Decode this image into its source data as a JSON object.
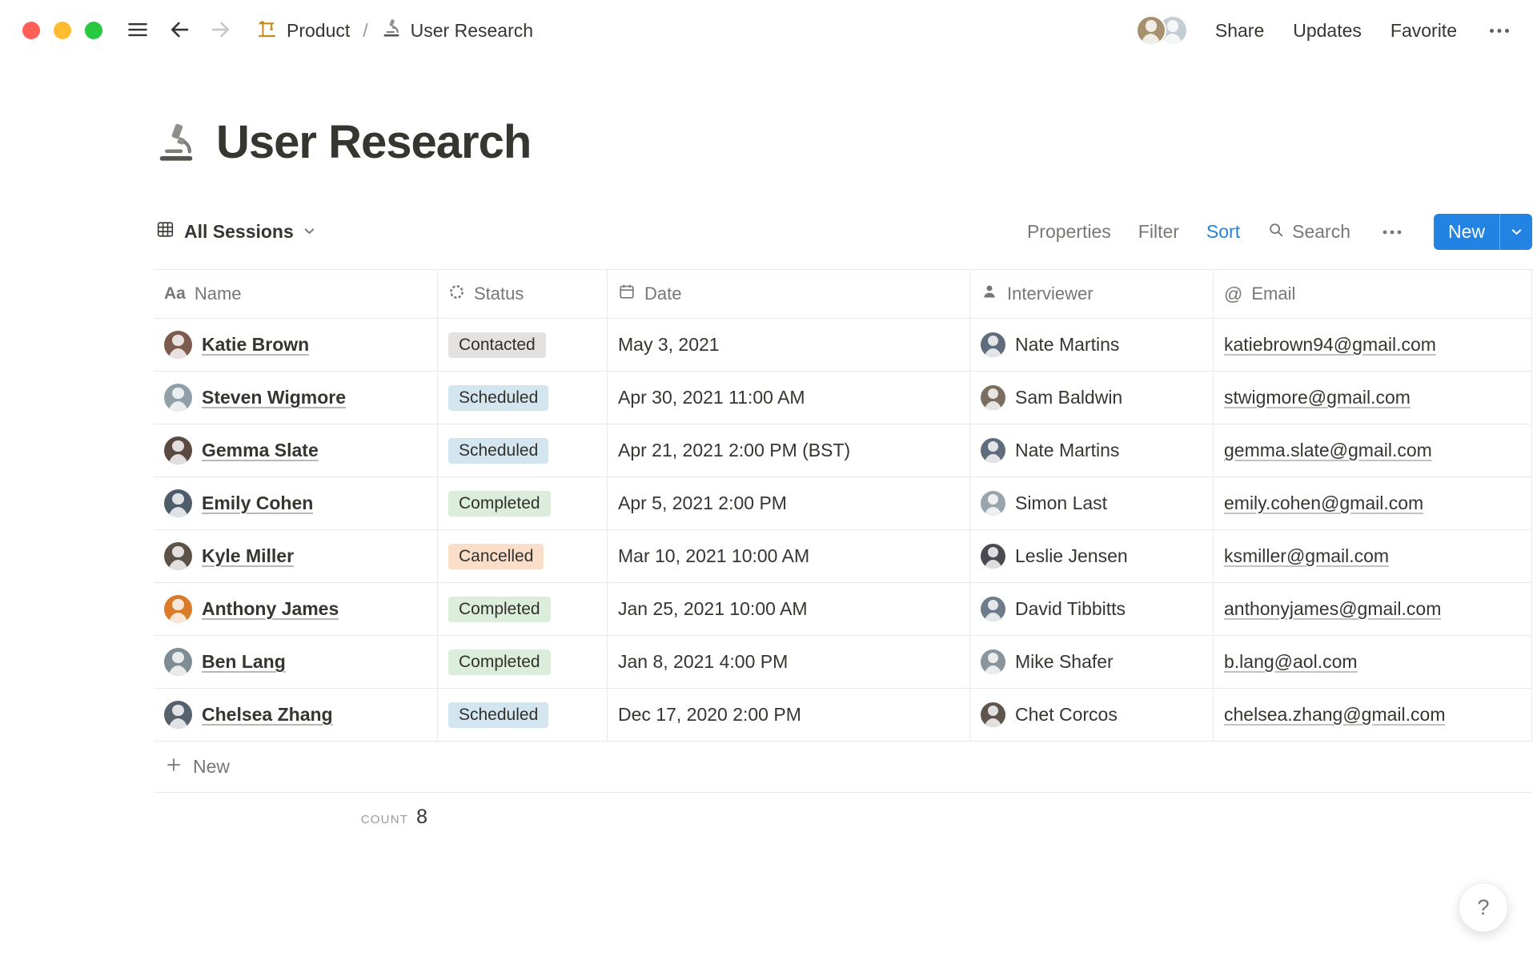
{
  "colors": {
    "accent_blue": "#2383E2",
    "status_gray_bg": "#E3E2E0",
    "status_blue_bg": "#D3E5EF",
    "status_green_bg": "#DBEDDB",
    "status_orange_bg": "#FADEC9"
  },
  "topbar": {
    "breadcrumb": [
      {
        "icon": "building-construction",
        "label": "Product"
      },
      {
        "icon": "microscope",
        "label": "User Research"
      }
    ],
    "separator": "/",
    "share": "Share",
    "updates": "Updates",
    "favorite": "Favorite"
  },
  "page": {
    "icon": "microscope",
    "title": "User Research"
  },
  "view_bar": {
    "view_name": "All Sessions",
    "properties": "Properties",
    "filter": "Filter",
    "sort": "Sort",
    "search": "Search",
    "new": "New"
  },
  "table": {
    "columns": [
      {
        "icon": "text-icon",
        "glyph": "Aa",
        "label": "Name"
      },
      {
        "icon": "status-icon",
        "label": "Status"
      },
      {
        "icon": "calendar-icon",
        "label": "Date"
      },
      {
        "icon": "person-icon",
        "label": "Interviewer"
      },
      {
        "icon": "at-icon",
        "glyph": "@",
        "label": "Email"
      }
    ],
    "rows": [
      {
        "name": "Katie Brown",
        "status": "Contacted",
        "status_color": "gray",
        "date": "May 3, 2021",
        "interviewer": "Nate Martins",
        "email": "katiebrown94@gmail.com"
      },
      {
        "name": "Steven Wigmore",
        "status": "Scheduled",
        "status_color": "blue",
        "date": "Apr 30, 2021 11:00 AM",
        "interviewer": "Sam Baldwin",
        "email": "stwigmore@gmail.com"
      },
      {
        "name": "Gemma Slate",
        "status": "Scheduled",
        "status_color": "blue",
        "date": "Apr 21, 2021 2:00 PM (BST)",
        "interviewer": "Nate Martins",
        "email": "gemma.slate@gmail.com"
      },
      {
        "name": "Emily Cohen",
        "status": "Completed",
        "status_color": "green",
        "date": "Apr 5, 2021 2:00 PM",
        "interviewer": "Simon Last",
        "email": "emily.cohen@gmail.com"
      },
      {
        "name": "Kyle Miller",
        "status": "Cancelled",
        "status_color": "orange",
        "date": "Mar 10, 2021 10:00 AM",
        "interviewer": "Leslie Jensen",
        "email": "ksmiller@gmail.com"
      },
      {
        "name": "Anthony James",
        "status": "Completed",
        "status_color": "green",
        "date": "Jan 25, 2021 10:00 AM",
        "interviewer": "David Tibbitts",
        "email": "anthonyjames@gmail.com"
      },
      {
        "name": "Ben Lang",
        "status": "Completed",
        "status_color": "green",
        "date": "Jan 8, 2021 4:00 PM",
        "interviewer": "Mike Shafer",
        "email": "b.lang@aol.com"
      },
      {
        "name": "Chelsea Zhang",
        "status": "Scheduled",
        "status_color": "blue",
        "date": "Dec 17, 2020 2:00 PM",
        "interviewer": "Chet Corcos",
        "email": "chelsea.zhang@gmail.com"
      }
    ],
    "new_row_label": "New",
    "count_label": "COUNT",
    "count_value": "8"
  },
  "help": {
    "label": "?"
  }
}
